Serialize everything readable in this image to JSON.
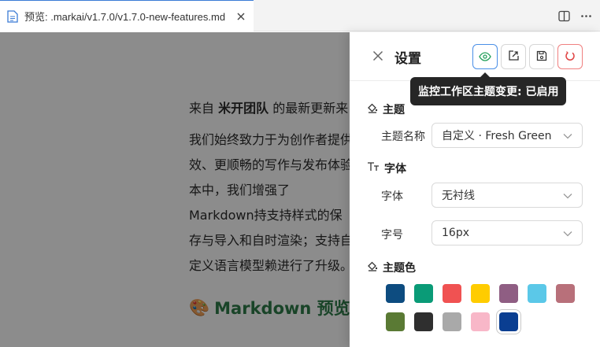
{
  "tab": {
    "title": "预览: .markai/v1.7.0/v1.7.0-new-features.md",
    "icons": {
      "file": "preview-file-icon",
      "close": "close-icon",
      "split": "split-editor-icon",
      "more": "more-icon"
    }
  },
  "preview": {
    "intro_prefix": "来自 ",
    "intro_team": "米开团队",
    "intro_suffix": " 的最新更新来",
    "paragraph": "我们始终致力于为创作者提供效、更顺畅的写作与发布体验本中，我们增强了Markdown持支持样式的保存与导入和自时渲染；支持自定义语言模型赖进行了升级。",
    "heading_emoji": "🎨",
    "heading": "Markdown 预览增强"
  },
  "settings": {
    "title": "设置",
    "tooltip": "监控工作区主题变更: 已启用",
    "theme_section": "主题",
    "theme_name_label": "主题名称",
    "theme_name_value": "自定义 · Fresh Green",
    "font_section": "字体",
    "font_label": "字体",
    "font_value": "无衬线",
    "size_label": "字号",
    "size_value": "16px",
    "color_section": "主题色",
    "colors": [
      "#0d4c80",
      "#0a9b77",
      "#f05252",
      "#ffcc00",
      "#8f5e83",
      "#5bc8e8",
      "#b8707a",
      "#5a7a34",
      "#2f2f2f",
      "#a9a9a9",
      "#f8b7c8",
      "#0a3e91"
    ],
    "selected_color_index": 11,
    "accent": "#4a8fe7"
  }
}
